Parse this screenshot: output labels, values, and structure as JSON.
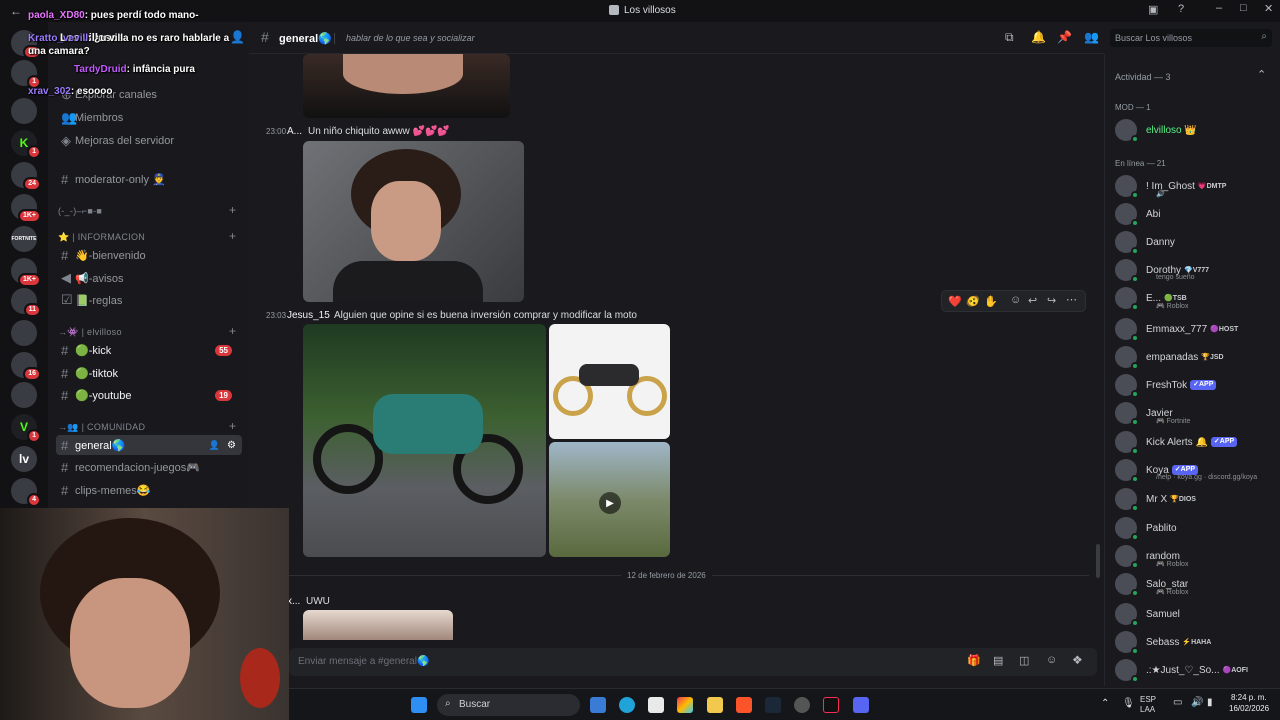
{
  "window": {
    "title": "Los villosos",
    "back_icon": "back-arrow-icon"
  },
  "server_icons": [
    {
      "label": "",
      "badge": "20"
    },
    {
      "label": "",
      "badge": "1"
    },
    {
      "label": "",
      "badge": ""
    },
    {
      "label": "K",
      "badge": "1",
      "color": "#53fc18"
    },
    {
      "label": "",
      "badge": "24"
    },
    {
      "label": "",
      "badge": "1K+"
    },
    {
      "label": "FORTNITE",
      "badge": ""
    },
    {
      "label": "",
      "badge": "1K+"
    },
    {
      "label": "",
      "badge": "11"
    },
    {
      "label": "",
      "badge": ""
    },
    {
      "label": "",
      "badge": "16"
    },
    {
      "label": "",
      "badge": ""
    },
    {
      "label": "V",
      "badge": "1",
      "color": "#53fc18"
    },
    {
      "label": "lv",
      "badge": ""
    },
    {
      "label": "",
      "badge": "4"
    }
  ],
  "overlay_chat": [
    {
      "user": "paola_XD80",
      "text": ": pues perdí todo mano-",
      "color": "#e774ff"
    },
    {
      "user": "Kratto_vevill",
      "text": ": ¿u villa no es raro hablarle a una camara?",
      "color": "#9c7bff"
    },
    {
      "user": "TardyDruid",
      "text": ": infância pura",
      "color": "#c25bff"
    },
    {
      "user": "xrav_302",
      "text": ": esoooo",
      "color": "#9c7bff"
    }
  ],
  "sidebar": {
    "server_name": "Los villosos",
    "faded_items": [
      "Explorar canales"
    ],
    "nav": [
      {
        "label": "Miembros",
        "icon": "members-icon"
      },
      {
        "label": "Mejoras del servidor",
        "icon": "boost-icon"
      }
    ],
    "channels_top": [
      {
        "label": "moderator-only 👮"
      }
    ],
    "cat1": "(-_-)–⌐■-■",
    "cat_info": "⭐ | INFORMACION",
    "info_channels": [
      {
        "label": "👋-bienvenido"
      },
      {
        "label": "📢-avisos"
      },
      {
        "label": "📗-reglas"
      }
    ],
    "cat_villoso": "→👾 | elvilloso",
    "villoso_channels": [
      {
        "label": "🟢-kick",
        "count": "55"
      },
      {
        "label": "🟢-tiktok",
        "count": ""
      },
      {
        "label": "🟢-youtube",
        "count": "19"
      }
    ],
    "cat_comunidad": "→👥 | COMUNIDAD",
    "comunidad_channels": [
      {
        "label": "general🌎",
        "active": true
      },
      {
        "label": "recomendacion-juegos🎮"
      },
      {
        "label": "clips-memes😂"
      }
    ]
  },
  "header": {
    "channel": "general🌎",
    "topic": "hablar de lo que sea y socializar",
    "search_placeholder": "Buscar Los villosos"
  },
  "messages": [
    {
      "time": "23:00",
      "author": "A...",
      "text": "Un niño chiquito awww 💕💕💕"
    },
    {
      "time": "23:03",
      "author": "Jesus_15",
      "text": "Alguien que opine si es buena inversión comprar y modificar la moto"
    },
    {
      "time": "",
      "author": "x...",
      "text": "UWU"
    }
  ],
  "date_divider": "12 de febrero de 2026",
  "reactions": [
    "❤️",
    "🫨",
    "✋"
  ],
  "composer_placeholder": "Enviar mensaje a #general🌎",
  "members": {
    "activity": "Actividad — 3",
    "mod_header": "MOD — 1",
    "online_header": "En línea — 21",
    "mods": [
      {
        "name": "elvilloso 👑",
        "color": "#57f287"
      }
    ],
    "online": [
      {
        "name": "! Im_Ghost",
        "tag": "💗DMTP",
        "sub": "🔊",
        "color": "#d2d4d8"
      },
      {
        "name": "Abi",
        "tag": "",
        "sub": "",
        "color": "#d2d4d8"
      },
      {
        "name": "Danny",
        "tag": "",
        "sub": "",
        "color": "#d2d4d8"
      },
      {
        "name": "Dorothy",
        "tag": "💎V777",
        "sub": "tengo sueño",
        "color": "#d2d4d8"
      },
      {
        "name": "E...",
        "tag": "🟢TSB",
        "sub": "🎮 Roblox",
        "color": "#d2d4d8"
      },
      {
        "name": "Emmaxx_777",
        "tag": "🟣HOST",
        "sub": "",
        "color": "#d2d4d8"
      },
      {
        "name": "empanadas",
        "tag": "🏆JSD",
        "sub": "",
        "color": "#d2d4d8"
      },
      {
        "name": "FreshTok",
        "tag": "✓APP",
        "sub": "",
        "color": "#d2d4d8",
        "app": true
      },
      {
        "name": "Javier",
        "tag": "",
        "sub": "🎮 Fortnite",
        "color": "#d2d4d8"
      },
      {
        "name": "Kick Alerts 🔔",
        "tag": "✓APP",
        "sub": "",
        "color": "#d2d4d8",
        "app": true
      },
      {
        "name": "Koya",
        "tag": "✓APP",
        "sub": "/help · koya.gg · discord.gg/koya",
        "color": "#d2d4d8",
        "app": true
      },
      {
        "name": "Mr X",
        "tag": "🏆DIOS",
        "sub": "",
        "color": "#d2d4d8"
      },
      {
        "name": "Pablito",
        "tag": "",
        "sub": "",
        "color": "#d2d4d8"
      },
      {
        "name": "random",
        "tag": "",
        "sub": "🎮 Roblox",
        "color": "#d2d4d8"
      },
      {
        "name": "Salo_star",
        "tag": "",
        "sub": "🎮 Roblox",
        "color": "#d2d4d8"
      },
      {
        "name": "Samuel",
        "tag": "",
        "sub": "",
        "color": "#d2d4d8"
      },
      {
        "name": "Sebass",
        "tag": "⚡HAHA",
        "sub": "",
        "color": "#d2d4d8"
      },
      {
        "name": ".:★Just_♡_So...",
        "tag": "🟣AOFI",
        "sub": "",
        "color": "#d2d4d8"
      }
    ]
  },
  "taskbar": {
    "search_label": "Buscar",
    "lang": "ESP",
    "lang2": "LAA",
    "time": "8:24 p. m.",
    "date": "16/02/2026"
  }
}
